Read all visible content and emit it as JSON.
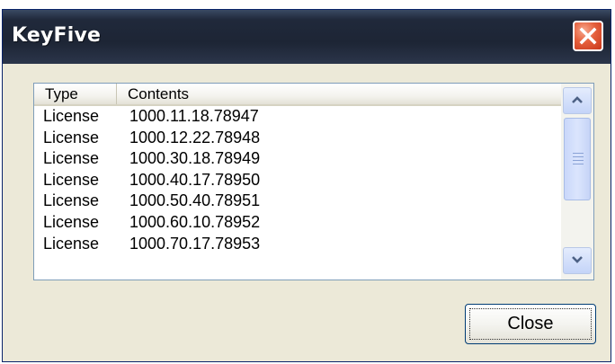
{
  "window": {
    "title": "KeyFive"
  },
  "listview": {
    "columns": [
      "Type",
      "Contents"
    ],
    "rows": [
      {
        "type": "License",
        "contents": "1000.11.18.78947"
      },
      {
        "type": "License",
        "contents": "1000.12.22.78948"
      },
      {
        "type": "License",
        "contents": "1000.30.18.78949"
      },
      {
        "type": "License",
        "contents": "1000.40.17.78950"
      },
      {
        "type": "License",
        "contents": "1000.50.40.78951"
      },
      {
        "type": "License",
        "contents": "1000.60.10.78952"
      },
      {
        "type": "License",
        "contents": "1000.70.17.78953"
      }
    ]
  },
  "buttons": {
    "close_label": "Close"
  },
  "icons": {
    "title_close": "close-icon",
    "scroll_up": "chevron-up-icon",
    "scroll_down": "chevron-down-icon"
  },
  "colors": {
    "titlebar": "#1d2535",
    "close_button_red": "#e5603c",
    "dialog_face": "#ece9d8",
    "scrollbar_accent": "#c4d4f8"
  }
}
